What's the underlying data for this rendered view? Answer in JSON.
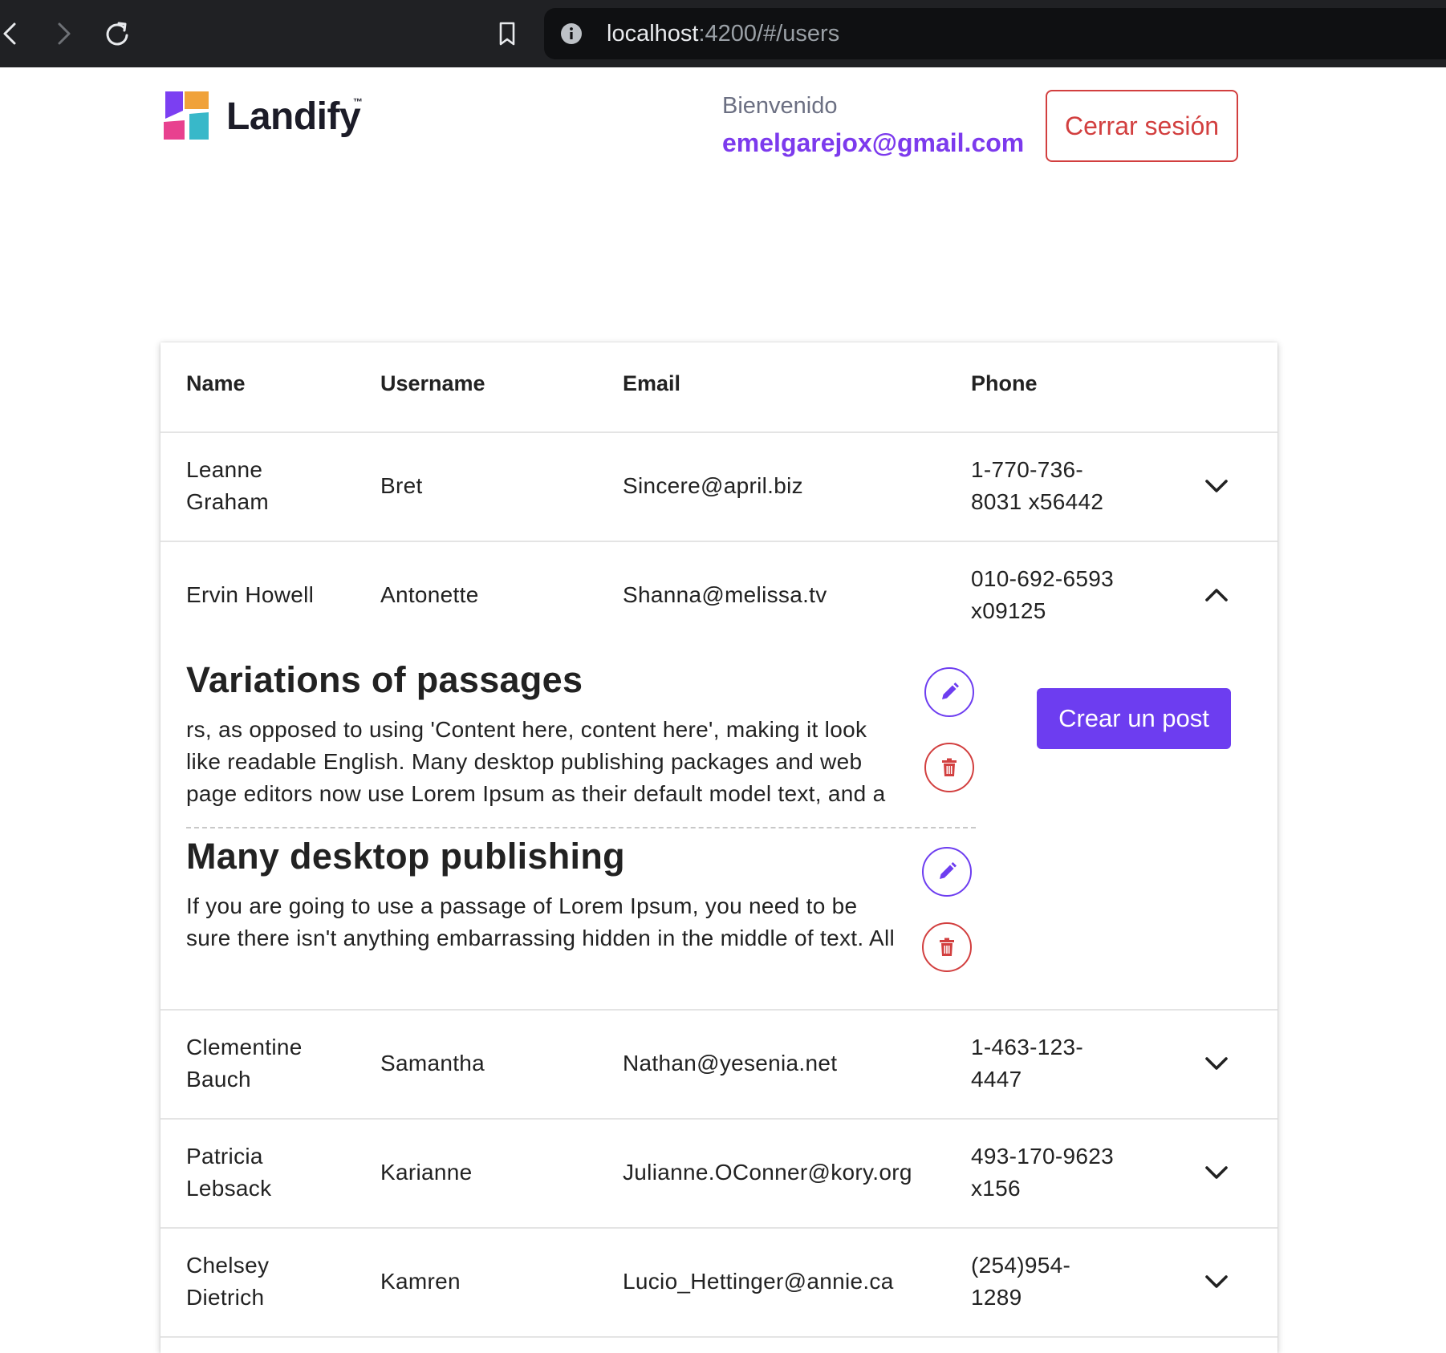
{
  "browser": {
    "url_host": "localhost",
    "url_path": ":4200/#/users"
  },
  "header": {
    "brand": "Landify",
    "brand_mark": "™",
    "welcome": "Bienvenido",
    "user_email": "emelgarejox@gmail.com",
    "logout_label": "Cerrar sesión"
  },
  "table": {
    "columns": [
      "Name",
      "Username",
      "Email",
      "Phone"
    ],
    "rows": [
      {
        "name": "Leanne\nGraham",
        "username": "Bret",
        "email": "Sincere@april.biz",
        "phone": "1-770-736-\n8031 x56442",
        "expanded": false
      },
      {
        "name": "Ervin Howell",
        "username": "Antonette",
        "email": "Shanna@melissa.tv",
        "phone": "010-692-6593\nx09125",
        "expanded": true
      },
      {
        "name": "Clementine\nBauch",
        "username": "Samantha",
        "email": "Nathan@yesenia.net",
        "phone": "1-463-123-\n4447",
        "expanded": false
      },
      {
        "name": "Patricia\nLebsack",
        "username": "Karianne",
        "email": "Julianne.OConner@kory.org",
        "phone": "493-170-9623\nx156",
        "expanded": false
      },
      {
        "name": "Chelsey\nDietrich",
        "username": "Kamren",
        "email": "Lucio_Hettinger@annie.ca",
        "phone": "(254)954-\n1289",
        "expanded": false
      }
    ]
  },
  "expanded_detail": {
    "create_post_label": "Crear un post",
    "posts": [
      {
        "title": "Variations of passages",
        "body": "rs, as opposed to using 'Content here, content here', making it look\nlike readable English. Many desktop publishing packages and web\npage editors now use Lorem Ipsum as their default model text, and a"
      },
      {
        "title": "Many desktop publishing",
        "body": "If you are going to use a passage of Lorem Ipsum, you need to be\nsure there isn't anything embarrassing hidden in the middle of text. All"
      }
    ]
  },
  "icons": {
    "back": "chevron-left-icon",
    "forward": "chevron-right-icon",
    "reload": "reload-icon",
    "bookmark": "bookmark-icon",
    "site_info": "info-icon",
    "expand": "chevron-down-icon",
    "collapse": "chevron-up-icon",
    "edit": "pencil-icon",
    "delete": "trash-icon"
  },
  "colors": {
    "accent": "#6d3df0",
    "email_text": "#7c3aed",
    "danger": "#d23f3f"
  }
}
